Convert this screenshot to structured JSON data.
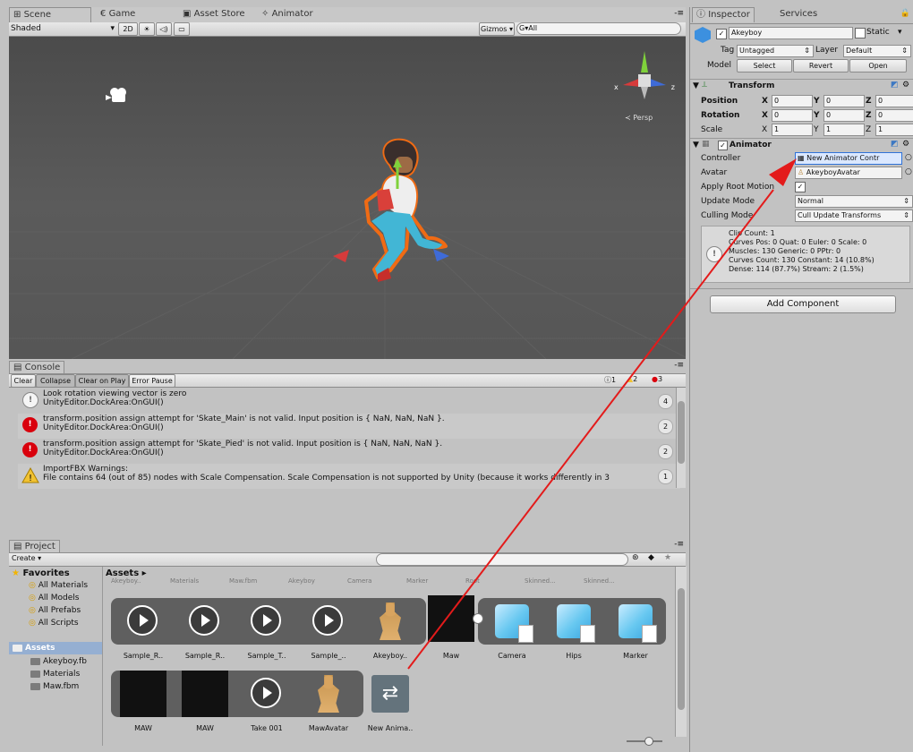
{
  "scene_tabs": [
    "Scene",
    "Game",
    "Asset Store",
    "Animator"
  ],
  "scene_toolbar": {
    "shading": "Shaded",
    "mode_2d": "2D",
    "gizmos": "Gizmos",
    "search_placeholder": "G▾All"
  },
  "viewport": {
    "persp_label": "≺ Persp",
    "gizmo_axes": {
      "x": "x",
      "z": "z"
    }
  },
  "inspector": {
    "tabs": [
      "Inspector",
      "Services"
    ],
    "object_name": "Akeyboy",
    "static_label": "Static",
    "tag_label": "Tag",
    "tag_value": "Untagged",
    "layer_label": "Layer",
    "layer_value": "Default",
    "model_label": "Model",
    "model_buttons": [
      "Select",
      "Revert",
      "Open"
    ],
    "transform_title": "Transform",
    "position_label": "Position",
    "rotation_label": "Rotation",
    "scale_label": "Scale",
    "position_values": {
      "x": "0",
      "y": "0",
      "z": "0"
    },
    "rotation_values": {
      "x": "0",
      "y": "0",
      "z": "0"
    },
    "scale_values": {
      "x": "1",
      "y": "1",
      "z": "1"
    },
    "animator_title": "Animator",
    "controller_label": "Controller",
    "controller_value": "New Animator Contr",
    "avatar_label": "Avatar",
    "avatar_value": "AkeyboyAvatar",
    "apply_root_motion_label": "Apply Root Motion",
    "update_mode_label": "Update Mode",
    "update_mode_value": "Normal",
    "culling_mode_label": "Culling Mode",
    "culling_mode_value": "Cull Update Transforms",
    "info_lines": [
      "Clip Count: 1",
      "Curves Pos: 0 Quat: 0 Euler: 0 Scale: 0",
      "Muscles: 130 Generic: 0 PPtr: 0",
      "Curves Count: 130 Constant: 14 (10.8%)",
      "Dense: 114 (87.7%) Stream: 2 (1.5%)"
    ],
    "add_component": "Add Component"
  },
  "console": {
    "title": "Console",
    "buttons": [
      "Clear",
      "Collapse",
      "Clear on Play",
      "Error Pause"
    ],
    "counts": {
      "info": "1",
      "warn": "2",
      "error": "3"
    },
    "messages": [
      {
        "line1": "Look rotation viewing vector is zero",
        "line2": "UnityEditor.DockArea:OnGUI()",
        "count": "4",
        "type": "info"
      },
      {
        "line1": "transform.position assign attempt for 'Skate_Main' is not valid. Input position is { NaN, NaN, NaN }.",
        "line2": "UnityEditor.DockArea:OnGUI()",
        "count": "2",
        "type": "error"
      },
      {
        "line1": "transform.position assign attempt for 'Skate_Pied' is not valid. Input position is { NaN, NaN, NaN }.",
        "line2": "UnityEditor.DockArea:OnGUI()",
        "count": "2",
        "type": "error"
      },
      {
        "line1": "ImportFBX Warnings:",
        "line2": "File contains 64 (out of 85) nodes with Scale Compensation. Scale Compensation is not supported by Unity (because it works differently in 3",
        "count": "1",
        "type": "warn"
      }
    ]
  },
  "project": {
    "title": "Project",
    "create": "Create",
    "favorites_title": "Favorites",
    "favorites": [
      "All Materials",
      "All Models",
      "All Prefabs",
      "All Scripts"
    ],
    "assets_title": "Assets",
    "assets_tree": [
      "Akeyboy.fb",
      "Materials",
      "Maw.fbm"
    ],
    "breadcrumb": "Assets ▸",
    "top_cut_labels": [
      "Akeyboy..",
      "Materials",
      "Maw.fbm",
      "Akeyboy",
      "Camera",
      "Marker",
      "Root",
      "Skinned...",
      "Skinned..."
    ],
    "row1": [
      "Sample_R..",
      "Sample_R..",
      "Sample_T..",
      "Sample_..",
      "Akeyboy..",
      "Maw",
      "Camera",
      "Hips",
      "Marker"
    ],
    "row2": [
      "MAW",
      "MAW",
      "Take 001",
      "MawAvatar",
      "New Anima.."
    ]
  },
  "colors": {
    "scene_bg": "#555555",
    "selection_outline": "#f06b14",
    "arrow": "#e31b1b",
    "error": "#d9000c",
    "warning": "#f1c232",
    "controller_highlight": "#2f72d8"
  }
}
